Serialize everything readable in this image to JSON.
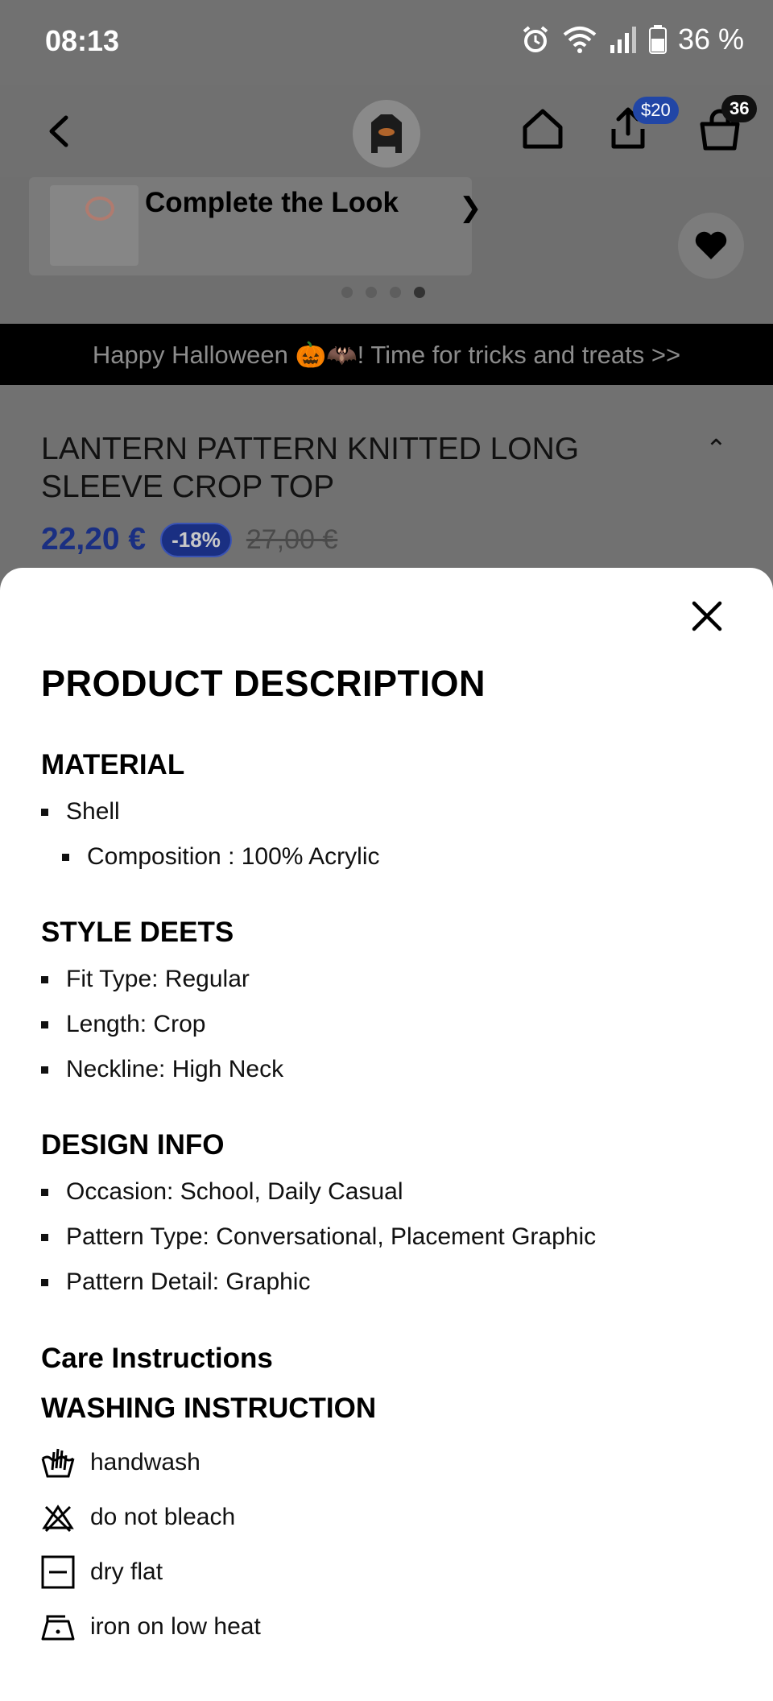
{
  "status_bar": {
    "time": "08:13",
    "battery": "36 %",
    "icons": [
      "alarm-icon",
      "wifi-icon",
      "signal-icon",
      "battery-icon"
    ]
  },
  "nav": {
    "share_badge": "$20",
    "cart_count": "36"
  },
  "gallery": {
    "complete_look_label": "Complete the Look",
    "dots_total": 4,
    "active_dot": 4
  },
  "promo": {
    "text": "Happy Halloween 🎃🦇! Time for tricks and treats >>"
  },
  "product": {
    "title": "LANTERN PATTERN KNITTED LONG SLEEVE CROP TOP",
    "price": "22,20 €",
    "discount": "-18%",
    "original_price": "27,00 €"
  },
  "sheet": {
    "title": "PRODUCT DESCRIPTION",
    "material": {
      "heading": "MATERIAL",
      "items": [
        "Shell"
      ],
      "sub_items": [
        "Composition : 100% Acrylic"
      ]
    },
    "style": {
      "heading": "STYLE DEETS",
      "items": [
        "Fit Type: Regular",
        "Length: Crop",
        "Neckline: High Neck"
      ]
    },
    "design": {
      "heading": "DESIGN INFO",
      "items": [
        "Occasion: School, Daily Casual",
        "Pattern Type: Conversational, Placement Graphic",
        "Pattern Detail: Graphic"
      ]
    },
    "care": {
      "heading": "Care Instructions",
      "washing_heading": "WASHING INSTRUCTION",
      "items": [
        {
          "icon": "handwash-icon",
          "label": "handwash"
        },
        {
          "icon": "do-not-bleach-icon",
          "label": "do not bleach"
        },
        {
          "icon": "dry-flat-icon",
          "label": "dry flat"
        },
        {
          "icon": "iron-low-heat-icon",
          "label": "iron on low heat"
        }
      ]
    }
  },
  "colors": {
    "price_blue": "#1a2f82",
    "overlay_gray": "#717171",
    "sheet_bg": "#ffffff"
  }
}
